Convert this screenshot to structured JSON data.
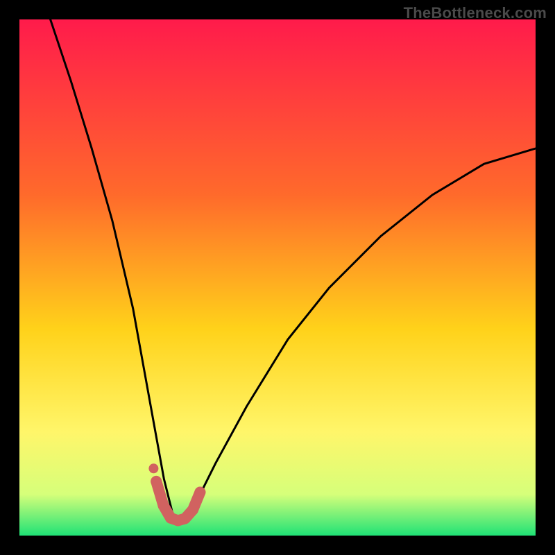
{
  "watermark": "TheBottleneck.com",
  "colors": {
    "frame": "#000000",
    "grad_top": "#ff1b4b",
    "grad_mid1": "#ff6a2b",
    "grad_mid2": "#ffd21a",
    "grad_mid3": "#fff66a",
    "grad_low": "#d6ff7a",
    "grad_bottom": "#1fe276",
    "curve": "#000000",
    "marker": "#d16260"
  },
  "chart_data": {
    "type": "line",
    "title": "",
    "xlabel": "",
    "ylabel": "",
    "xlim": [
      0,
      100
    ],
    "ylim": [
      0,
      100
    ],
    "note": "Axes are unlabeled; values are pixel-normalized 0–100. Curve is a V-shaped bottleneck profile with minimum near x≈30.",
    "series": [
      {
        "name": "bottleneck-curve",
        "x": [
          6,
          10,
          14,
          18,
          22,
          26,
          28,
          30,
          32,
          34,
          38,
          44,
          52,
          60,
          70,
          80,
          90,
          100
        ],
        "y": [
          100,
          88,
          75,
          61,
          44,
          22,
          11,
          3,
          3,
          6,
          14,
          25,
          38,
          48,
          58,
          66,
          72,
          75
        ]
      }
    ],
    "markers": {
      "name": "highlight-band",
      "color": "#d16260",
      "points_x": [
        26.5,
        27.9,
        29.3,
        30.7,
        32.1,
        33.6,
        35.0
      ],
      "points_y": [
        10.5,
        5.8,
        3.4,
        2.9,
        3.3,
        5.0,
        8.4
      ],
      "extra_dot": {
        "x": 26.0,
        "y": 13.0
      }
    },
    "background_gradient_stops": [
      {
        "pos": 0.0,
        "color": "#ff1b4b"
      },
      {
        "pos": 0.34,
        "color": "#ff6a2b"
      },
      {
        "pos": 0.6,
        "color": "#ffd21a"
      },
      {
        "pos": 0.8,
        "color": "#fff66a"
      },
      {
        "pos": 0.92,
        "color": "#d6ff7a"
      },
      {
        "pos": 1.0,
        "color": "#1fe276"
      }
    ]
  }
}
